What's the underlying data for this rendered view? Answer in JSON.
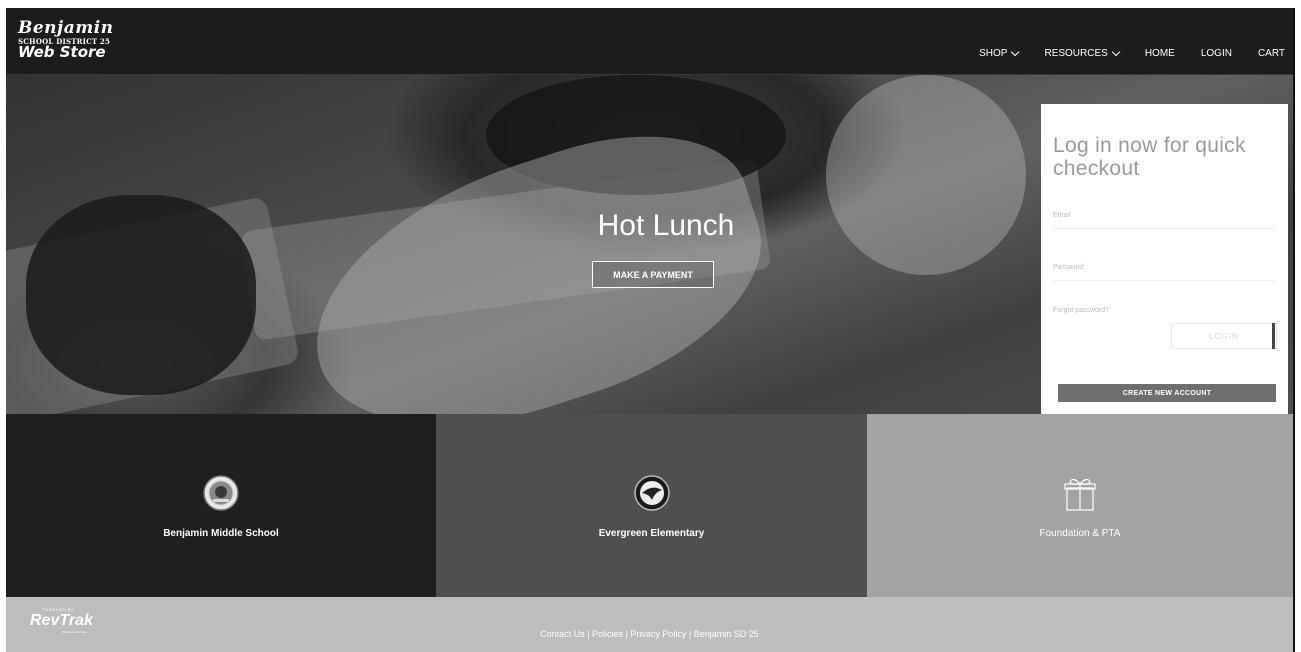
{
  "header": {
    "logo": {
      "line1": "Benjamin",
      "line2": "SCHOOL DISTRICT 25",
      "line3": "Web Store"
    },
    "nav": [
      {
        "label": "SHOP",
        "has_dropdown": true
      },
      {
        "label": "RESOURCES",
        "has_dropdown": true
      },
      {
        "label": "HOME",
        "has_dropdown": false
      },
      {
        "label": "LOGIN",
        "has_dropdown": false
      },
      {
        "label": "CART",
        "has_dropdown": false
      }
    ]
  },
  "hero": {
    "title": "Hot Lunch",
    "button_label": "MAKE A PAYMENT"
  },
  "login": {
    "title": "Log in now for quick checkout",
    "email_label": "Email",
    "password_label": "Password",
    "forgot_label": "Forgot password?",
    "login_button": "LOGIN",
    "create_button": "CREATE NEW ACCOUNT"
  },
  "tiles": [
    {
      "label": "Benjamin Middle School",
      "icon": "school-seal-icon"
    },
    {
      "label": "Evergreen Elementary",
      "icon": "evergreen-seal-icon"
    },
    {
      "label": "Foundation & PTA",
      "icon": "gift-icon"
    }
  ],
  "footer": {
    "powered_by": "POWERED BY",
    "brand": "RevTrak",
    "tagline": "Making Cash Flow",
    "links": [
      "Contact Us",
      "Policies",
      "Privacy Policy",
      "Benjamin SD 25"
    ],
    "separator": " | "
  },
  "colors": {
    "header_bg": "#1c1c1c",
    "tile1_bg": "#1f1f1f",
    "tile2_bg": "#4f4f4f",
    "tile3_bg": "#a3a3a3",
    "footer_bg": "#bdbdbd",
    "create_button_bg": "#6f6f6f"
  }
}
